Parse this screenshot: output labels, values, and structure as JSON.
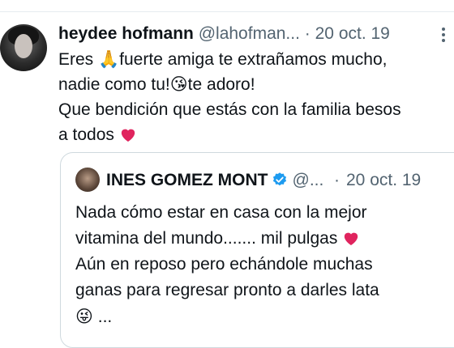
{
  "tweet": {
    "author_name": "heydee hofmann",
    "author_handle": "@lahofman...",
    "separator": "·",
    "date": "20 oct. 19",
    "lines": [
      {
        "before": "Eres ",
        "emoji": "🙏",
        "after": "fuerte amiga te extrañamos mucho,"
      },
      {
        "before": "nadie como tu!",
        "emoji": "😘",
        "after": "te adoro!"
      },
      {
        "before": "Que bendición que estás con la familia besos",
        "emoji": "",
        "after": ""
      },
      {
        "before": "a todos ",
        "emoji": "",
        "after": ""
      }
    ]
  },
  "quoted": {
    "author_name": "INES GOMEZ MONT",
    "author_handle": "@...",
    "separator": "·",
    "date": "20 oct. 19",
    "lines": [
      "Nada cómo estar en casa con la mejor",
      "vitamina del mundo....... mil pulgas ",
      "Aún en reposo pero echándole muchas",
      "ganas para regresar pronto  a darles lata",
      " ..."
    ],
    "last_emoji": "😜"
  },
  "colors": {
    "heart": "#e0245e",
    "verified": "#1d9bf0",
    "secondary_text": "#536471"
  }
}
